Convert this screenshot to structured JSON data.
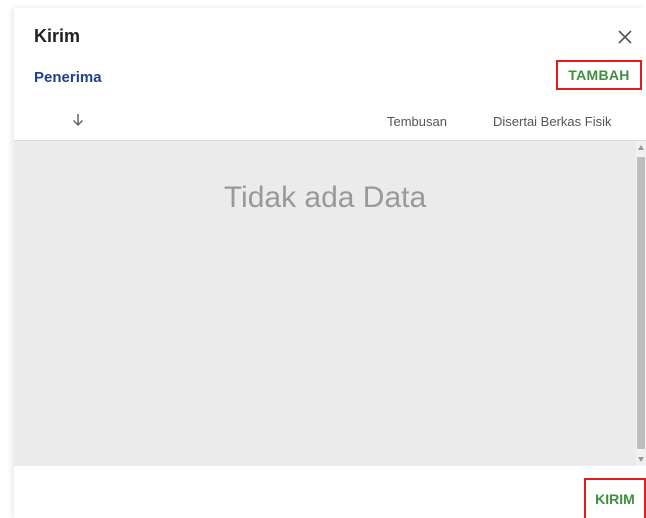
{
  "dialog": {
    "title": "Kirim",
    "close_icon": "close-icon"
  },
  "section": {
    "title": "Penerima",
    "add_label": "TAMBAH"
  },
  "table": {
    "sort_icon": "arrow-down-icon",
    "columns": [
      "Tembusan",
      "Disertai Berkas Fisik"
    ],
    "empty_message": "Tidak ada Data"
  },
  "footer": {
    "submit_label": "KIRIM"
  },
  "colors": {
    "section_title": "#1f3f8f",
    "button_text": "#3f8f3f",
    "highlight_border": "#e31b1b",
    "table_background": "#ebebeb"
  }
}
